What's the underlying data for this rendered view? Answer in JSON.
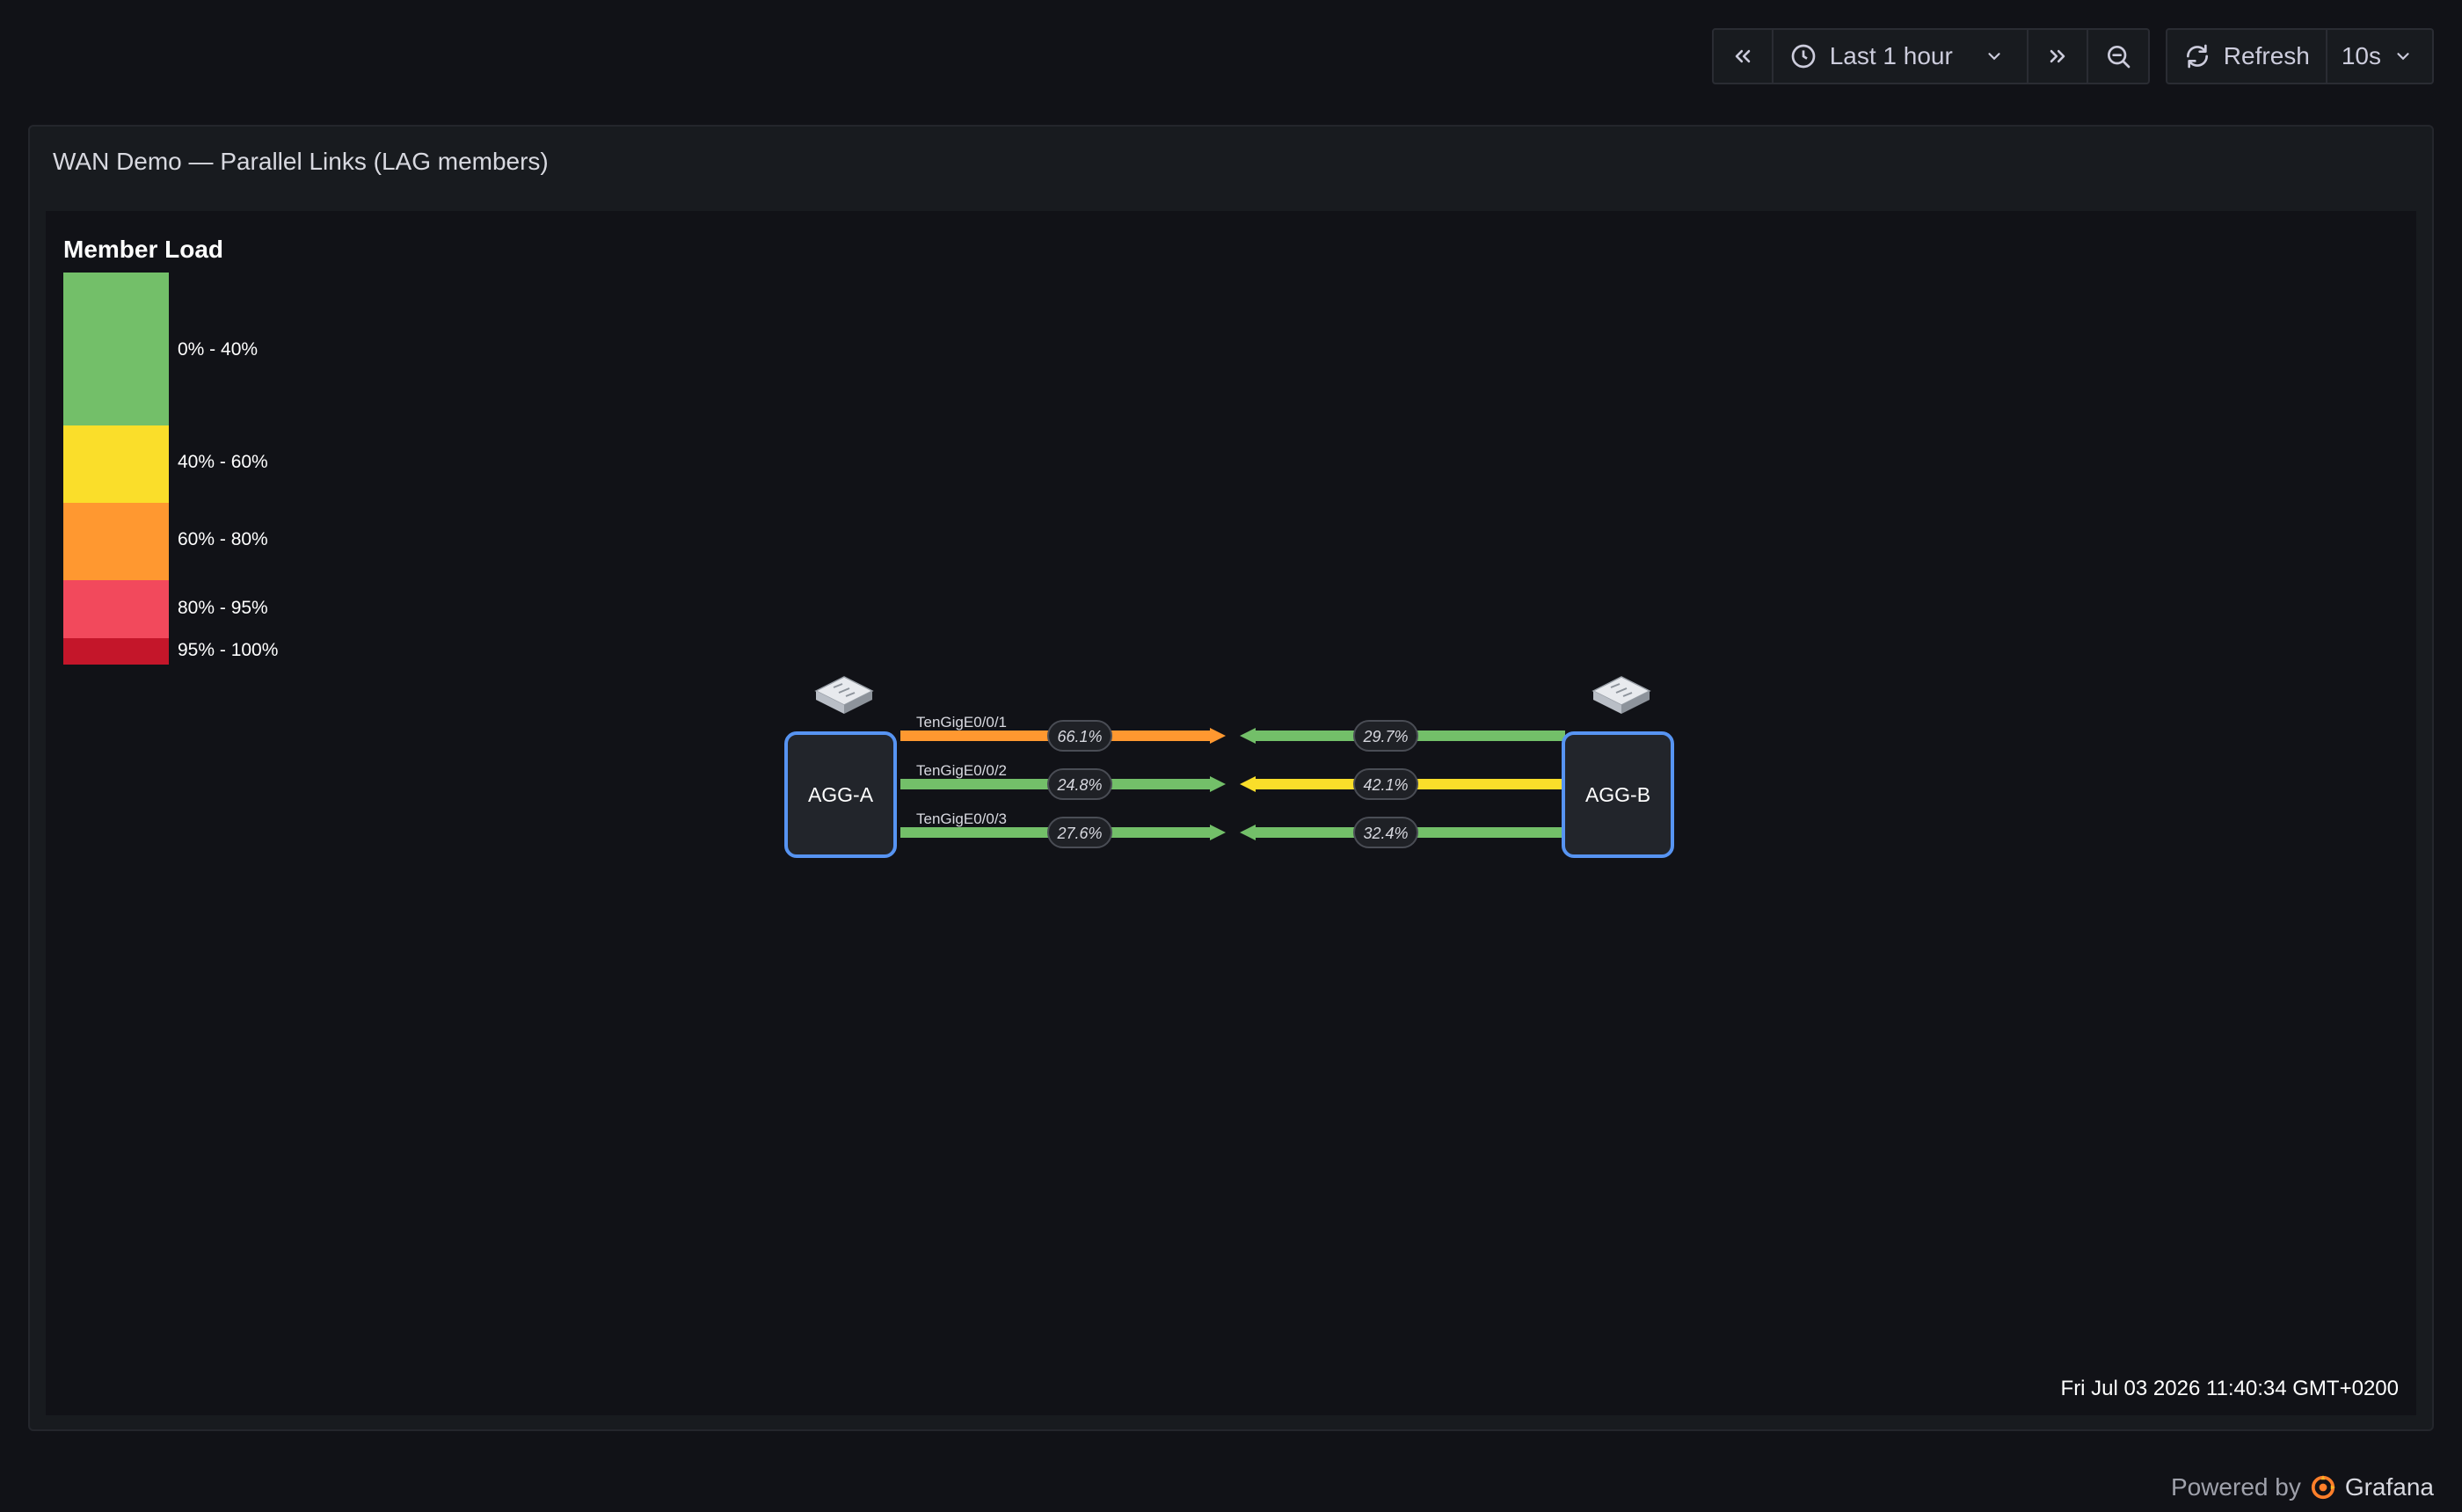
{
  "toolbar": {
    "time_range": "Last 1 hour",
    "refresh_label": "Refresh",
    "refresh_interval": "10s"
  },
  "panel": {
    "title": "WAN Demo — Parallel Links (LAG members)",
    "timestamp": "Fri Jul 03 2026 11:40:34 GMT+0200"
  },
  "legend": {
    "title": "Member Load",
    "items": [
      {
        "label": "0% - 40%",
        "color": "#73bf69"
      },
      {
        "label": "40% - 60%",
        "color": "#fade2a"
      },
      {
        "label": "60% - 80%",
        "color": "#ff9830"
      },
      {
        "label": "80% - 95%",
        "color": "#f2495c"
      },
      {
        "label": "95% - 100%",
        "color": "#c4162a"
      }
    ]
  },
  "nodes": {
    "a": {
      "label": "AGG-A"
    },
    "b": {
      "label": "AGG-B"
    }
  },
  "links": [
    {
      "name": "TenGigE0/0/1",
      "a_to_b": "66.1%",
      "b_to_a": "29.7%",
      "a_color": "#ff9830",
      "b_color": "#73bf69"
    },
    {
      "name": "TenGigE0/0/2",
      "a_to_b": "24.8%",
      "b_to_a": "42.1%",
      "a_color": "#73bf69",
      "b_color": "#fade2a"
    },
    {
      "name": "TenGigE0/0/3",
      "a_to_b": "27.6%",
      "b_to_a": "32.4%",
      "a_color": "#73bf69",
      "b_color": "#73bf69"
    }
  ],
  "footer": {
    "powered_by": "Powered by",
    "brand": "Grafana",
    "brand_color": "#ff7f2a"
  }
}
